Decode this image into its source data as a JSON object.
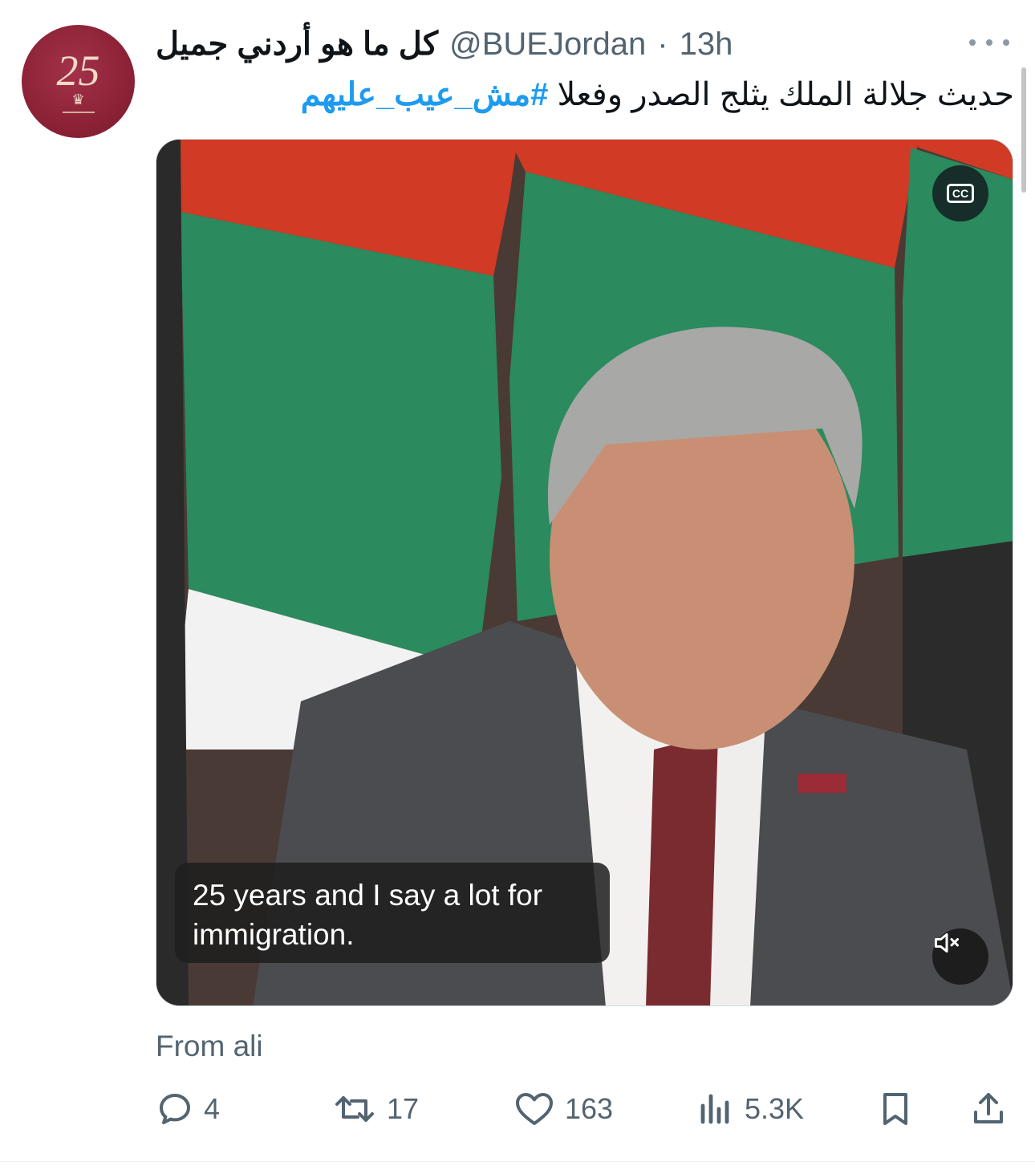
{
  "account": {
    "display_name": "كل ما هو أردني جميل",
    "handle": "@BUEJordan",
    "separator": "·",
    "time": "13h",
    "avatar_text": "25"
  },
  "tweet": {
    "text": "حديث جلالة الملك يثلج الصدر  وفعلا ",
    "hashtag": "#مش_عيب_عليهم"
  },
  "media": {
    "caption_line1": "25 years and I say a lot for",
    "caption_line2": "immigration.",
    "cc_label": "CC",
    "cc_icon": "closed-captions-icon",
    "mute_icon": "speaker-muted-icon"
  },
  "source": "From ali",
  "actions": {
    "replies": "4",
    "reposts": "17",
    "likes": "163",
    "views": "5.3K"
  },
  "colors": {
    "link": "#1d9bf0",
    "secondary_text": "#536471",
    "avatar_bg": "#8c2236"
  }
}
